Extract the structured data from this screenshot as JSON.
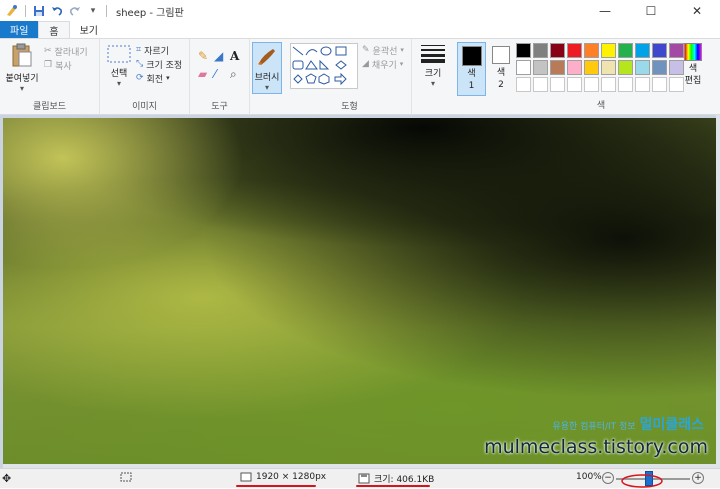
{
  "window": {
    "title": "sheep - 그림판",
    "minimize": "—",
    "maximize": "☐",
    "close": "✕"
  },
  "quick_access": {
    "dropdown": "▾"
  },
  "tabs": [
    {
      "label": "파일"
    },
    {
      "label": "홈"
    },
    {
      "label": "보기"
    }
  ],
  "clipboard": {
    "paste_label": "붙여넣기",
    "cut_label": "잘라내기",
    "copy_label": "복사",
    "group_label": "클립보드"
  },
  "image": {
    "select_label": "선택",
    "crop_label": "자르기",
    "resize_label": "크기 조정",
    "rotate_label": "회전",
    "group_label": "이미지"
  },
  "tools": {
    "group_label": "도구"
  },
  "brushes": {
    "label": "브러시"
  },
  "shapes": {
    "outline_label": "윤곽선",
    "fill_label": "채우기",
    "group_label": "도형"
  },
  "size": {
    "label": "크기"
  },
  "colors": {
    "color1_label": "색\n1",
    "color2_label": "색\n2",
    "edit_label": "색\n편집",
    "group_label": "색",
    "color1": "#000000",
    "color2": "#ffffff",
    "palette_row1": [
      "#000000",
      "#7f7f7f",
      "#880015",
      "#ed1c24",
      "#ff7f27",
      "#fff200",
      "#22b14c",
      "#00a2e8",
      "#3f48cc",
      "#a349a4"
    ],
    "palette_row2": [
      "#ffffff",
      "#c3c3c3",
      "#b97a57",
      "#ffaec9",
      "#ffc90e",
      "#efe4b0",
      "#b5e61d",
      "#99d9ea",
      "#7092be",
      "#c8bfe7"
    ]
  },
  "canvas": {
    "watermark_small": "유용한 컴퓨터/IT 정보",
    "watermark_brand": "멀미클래스",
    "watermark_url": "mulmeclass.tistory.com"
  },
  "status": {
    "dimensions": "1920 × 1280px",
    "filesize": "크기: 406.1KB",
    "zoom": "100%",
    "zoom_out": "−",
    "zoom_in": "+",
    "zoom_level": 0.45
  }
}
